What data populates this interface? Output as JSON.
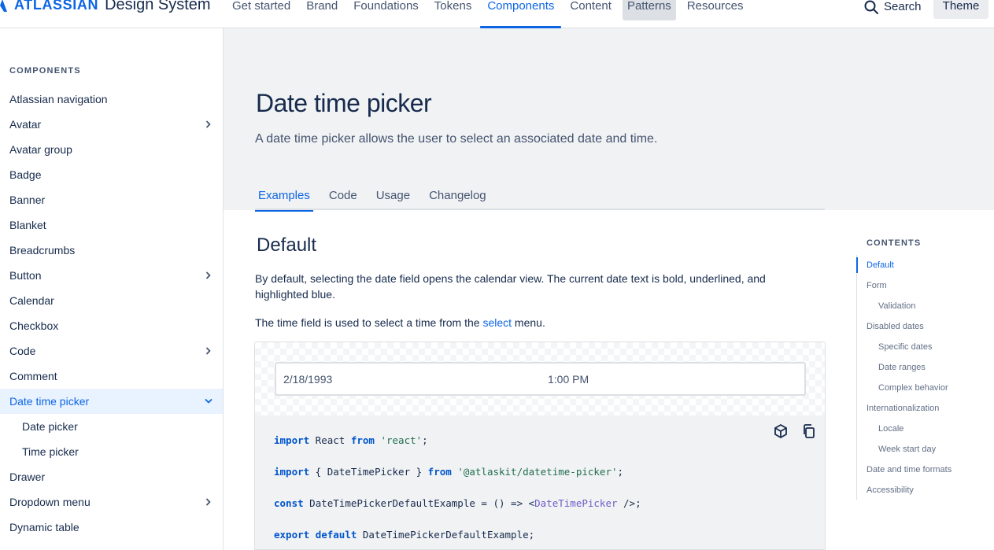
{
  "header": {
    "brand": "ATLASSIAN",
    "brand_suffix": "Design System",
    "nav": [
      "Get started",
      "Brand",
      "Foundations",
      "Tokens",
      "Components",
      "Content",
      "Patterns",
      "Resources"
    ],
    "active_nav": "Components",
    "hovered_nav": "Patterns",
    "search_label": "Search",
    "theme_label": "Theme"
  },
  "sidebar": {
    "heading": "COMPONENTS",
    "items": [
      {
        "label": "Atlassian navigation",
        "expandable": false
      },
      {
        "label": "Avatar",
        "expandable": true
      },
      {
        "label": "Avatar group",
        "expandable": false
      },
      {
        "label": "Badge",
        "expandable": false
      },
      {
        "label": "Banner",
        "expandable": false
      },
      {
        "label": "Blanket",
        "expandable": false
      },
      {
        "label": "Breadcrumbs",
        "expandable": false
      },
      {
        "label": "Button",
        "expandable": true
      },
      {
        "label": "Calendar",
        "expandable": false
      },
      {
        "label": "Checkbox",
        "expandable": false
      },
      {
        "label": "Code",
        "expandable": true
      },
      {
        "label": "Comment",
        "expandable": false
      },
      {
        "label": "Date time picker",
        "expandable": true,
        "selected": true,
        "expanded": true
      },
      {
        "label": "Date picker",
        "sub": true
      },
      {
        "label": "Time picker",
        "sub": true
      },
      {
        "label": "Drawer",
        "expandable": false
      },
      {
        "label": "Dropdown menu",
        "expandable": true
      },
      {
        "label": "Dynamic table",
        "expandable": false
      }
    ]
  },
  "page": {
    "title": "Date time picker",
    "description": "A date time picker allows the user to select an associated date and time.",
    "tabs": [
      "Examples",
      "Code",
      "Usage",
      "Changelog"
    ],
    "active_tab": "Examples",
    "section_title": "Default",
    "para1": "By default, selecting the date field opens the calendar view. The current date text is bold, underlined, and highlighted blue.",
    "para2_before": "The time field is used to select a time from the ",
    "para2_link": "select",
    "para2_after": " menu."
  },
  "example": {
    "date_value": "2/18/1993",
    "time_value": "1:00 PM",
    "code_lines": [
      [
        {
          "t": "import",
          "c": "kw"
        },
        {
          "t": " React "
        },
        {
          "t": "from",
          "c": "kw"
        },
        {
          "t": " "
        },
        {
          "t": "'react'",
          "c": "str"
        },
        {
          "t": ";"
        }
      ],
      [
        {
          "t": "import",
          "c": "kw"
        },
        {
          "t": " { DateTimePicker } "
        },
        {
          "t": "from",
          "c": "kw"
        },
        {
          "t": " "
        },
        {
          "t": "'@atlaskit/datetime-picker'",
          "c": "str"
        },
        {
          "t": ";"
        }
      ],
      [
        {
          "t": "const",
          "c": "kw"
        },
        {
          "t": " DateTimePickerDefaultExample = () => <"
        },
        {
          "t": "DateTimePicker",
          "c": "cmp"
        },
        {
          "t": " />;"
        }
      ],
      [
        {
          "t": "export",
          "c": "kw"
        },
        {
          "t": " "
        },
        {
          "t": "default",
          "c": "kw"
        },
        {
          "t": " DateTimePickerDefaultExample;"
        }
      ]
    ],
    "icons": [
      "codesandbox-icon",
      "copy-icon"
    ]
  },
  "toc": {
    "heading": "CONTENTS",
    "items": [
      {
        "label": "Default",
        "active": true
      },
      {
        "label": "Form"
      },
      {
        "label": "Validation",
        "sub": true
      },
      {
        "label": "Disabled dates"
      },
      {
        "label": "Specific dates",
        "sub": true
      },
      {
        "label": "Date ranges",
        "sub": true
      },
      {
        "label": "Complex behavior",
        "sub": true
      },
      {
        "label": "Internationalization"
      },
      {
        "label": "Locale",
        "sub": true
      },
      {
        "label": "Week start day",
        "sub": true
      },
      {
        "label": "Date and time formats"
      },
      {
        "label": "Accessibility"
      }
    ]
  },
  "colors": {
    "accent": "#0C66E4",
    "text": "#172B4D",
    "hero_bg": "#F1F2F4",
    "selected_bg": "#E9F2FF"
  }
}
